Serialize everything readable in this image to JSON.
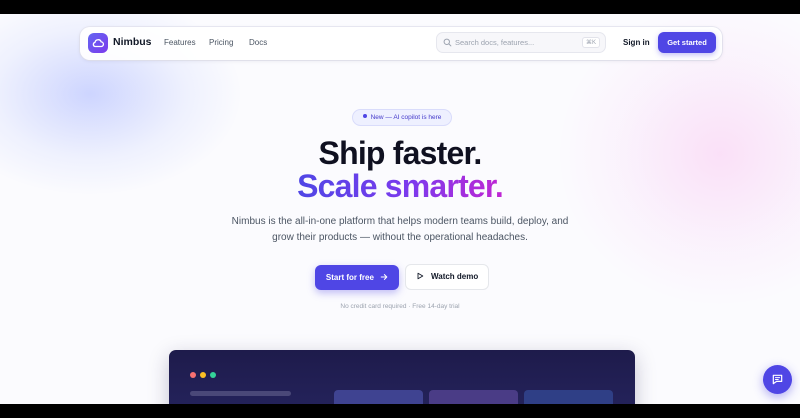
{
  "brand": {
    "name": "Nimbus",
    "accent": "#4f46e5"
  },
  "nav": {
    "links": [
      "Features",
      "Pricing",
      "Docs"
    ],
    "search": {
      "placeholder": "Search docs, features...",
      "shortcut": "⌘K"
    },
    "sign_in": "Sign in",
    "cta": "Get started"
  },
  "hero": {
    "badge": "New — AI copilot is here",
    "headline_line1": "Ship faster.",
    "headline_line2": "Scale smarter.",
    "subtitle": "Nimbus is the all-in-one platform that helps modern teams build, deploy, and grow their products — without the operational headaches.",
    "primary_cta": "Start for free",
    "secondary_cta": "Watch demo",
    "note": "No credit card required · Free 14-day trial"
  },
  "icons": {
    "logo": "cloud-icon",
    "search": "search-icon",
    "arrow": "arrow-right-icon",
    "play": "play-icon",
    "chat": "chat-icon"
  }
}
